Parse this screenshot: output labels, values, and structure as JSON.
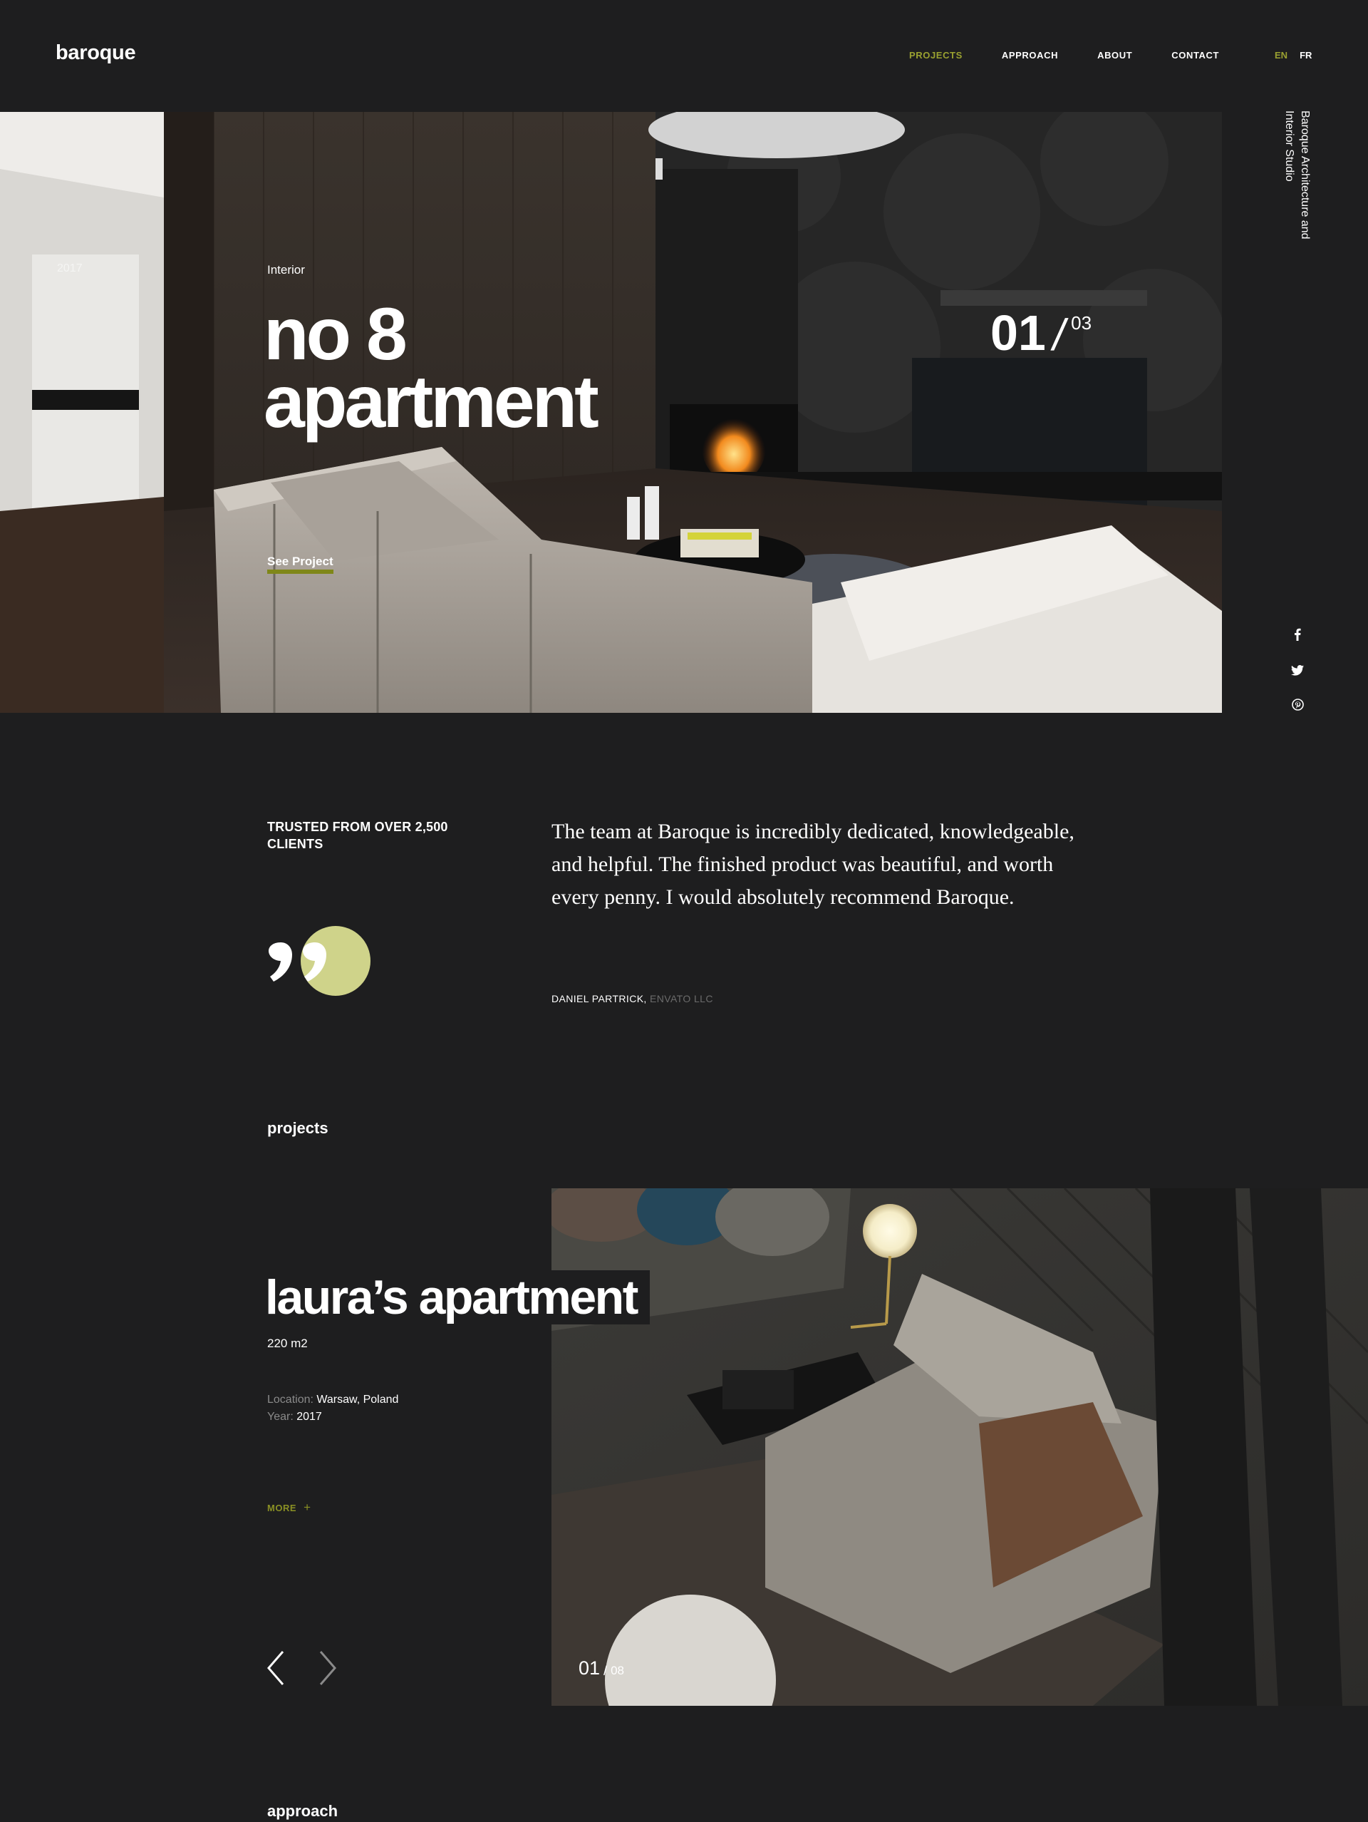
{
  "brand": {
    "logo": "baroque"
  },
  "nav": {
    "items": [
      "PROJECTS",
      "APPROACH",
      "ABOUT",
      "CONTACT"
    ],
    "active": "PROJECTS"
  },
  "lang": {
    "en": "EN",
    "fr": "FR",
    "active": "EN"
  },
  "hero": {
    "category": "Interior",
    "year": "2017",
    "title_line1": "no 8",
    "title_line2": "apartment",
    "cta": "See Project",
    "counter_current": "01",
    "counter_sep": "/",
    "counter_total": "03"
  },
  "side": {
    "tagline_line1": "Baroque Architecture and",
    "tagline_line2": "Interior Studio",
    "social": [
      "facebook-icon",
      "twitter-icon",
      "pinterest-icon"
    ]
  },
  "testimonial": {
    "heading": "TRUSTED FROM OVER 2,500 CLIENTS",
    "quote": "The team at Baroque is incredibly dedicated, knowledgeable, and helpful. The finished product was beautiful, and worth every penny. I would absolutely recommend Baroque.",
    "author": "DANIEL PARTRICK,",
    "company": "ENVATO LLC"
  },
  "projects": {
    "section_label": "projects",
    "title": "laura’s apartment",
    "area": "220 m2",
    "location_label": "Location:",
    "location": "Warsaw, Poland",
    "year_label": "Year:",
    "year": "2017",
    "more": "MORE",
    "more_icon": "+",
    "counter_current": "01",
    "counter_sep": "/",
    "counter_total": "08"
  },
  "approach": {
    "section_label": "approach"
  },
  "colors": {
    "accent": "#9aa130",
    "quote_circle": "#cfd38a",
    "background": "#1e1e1f"
  }
}
